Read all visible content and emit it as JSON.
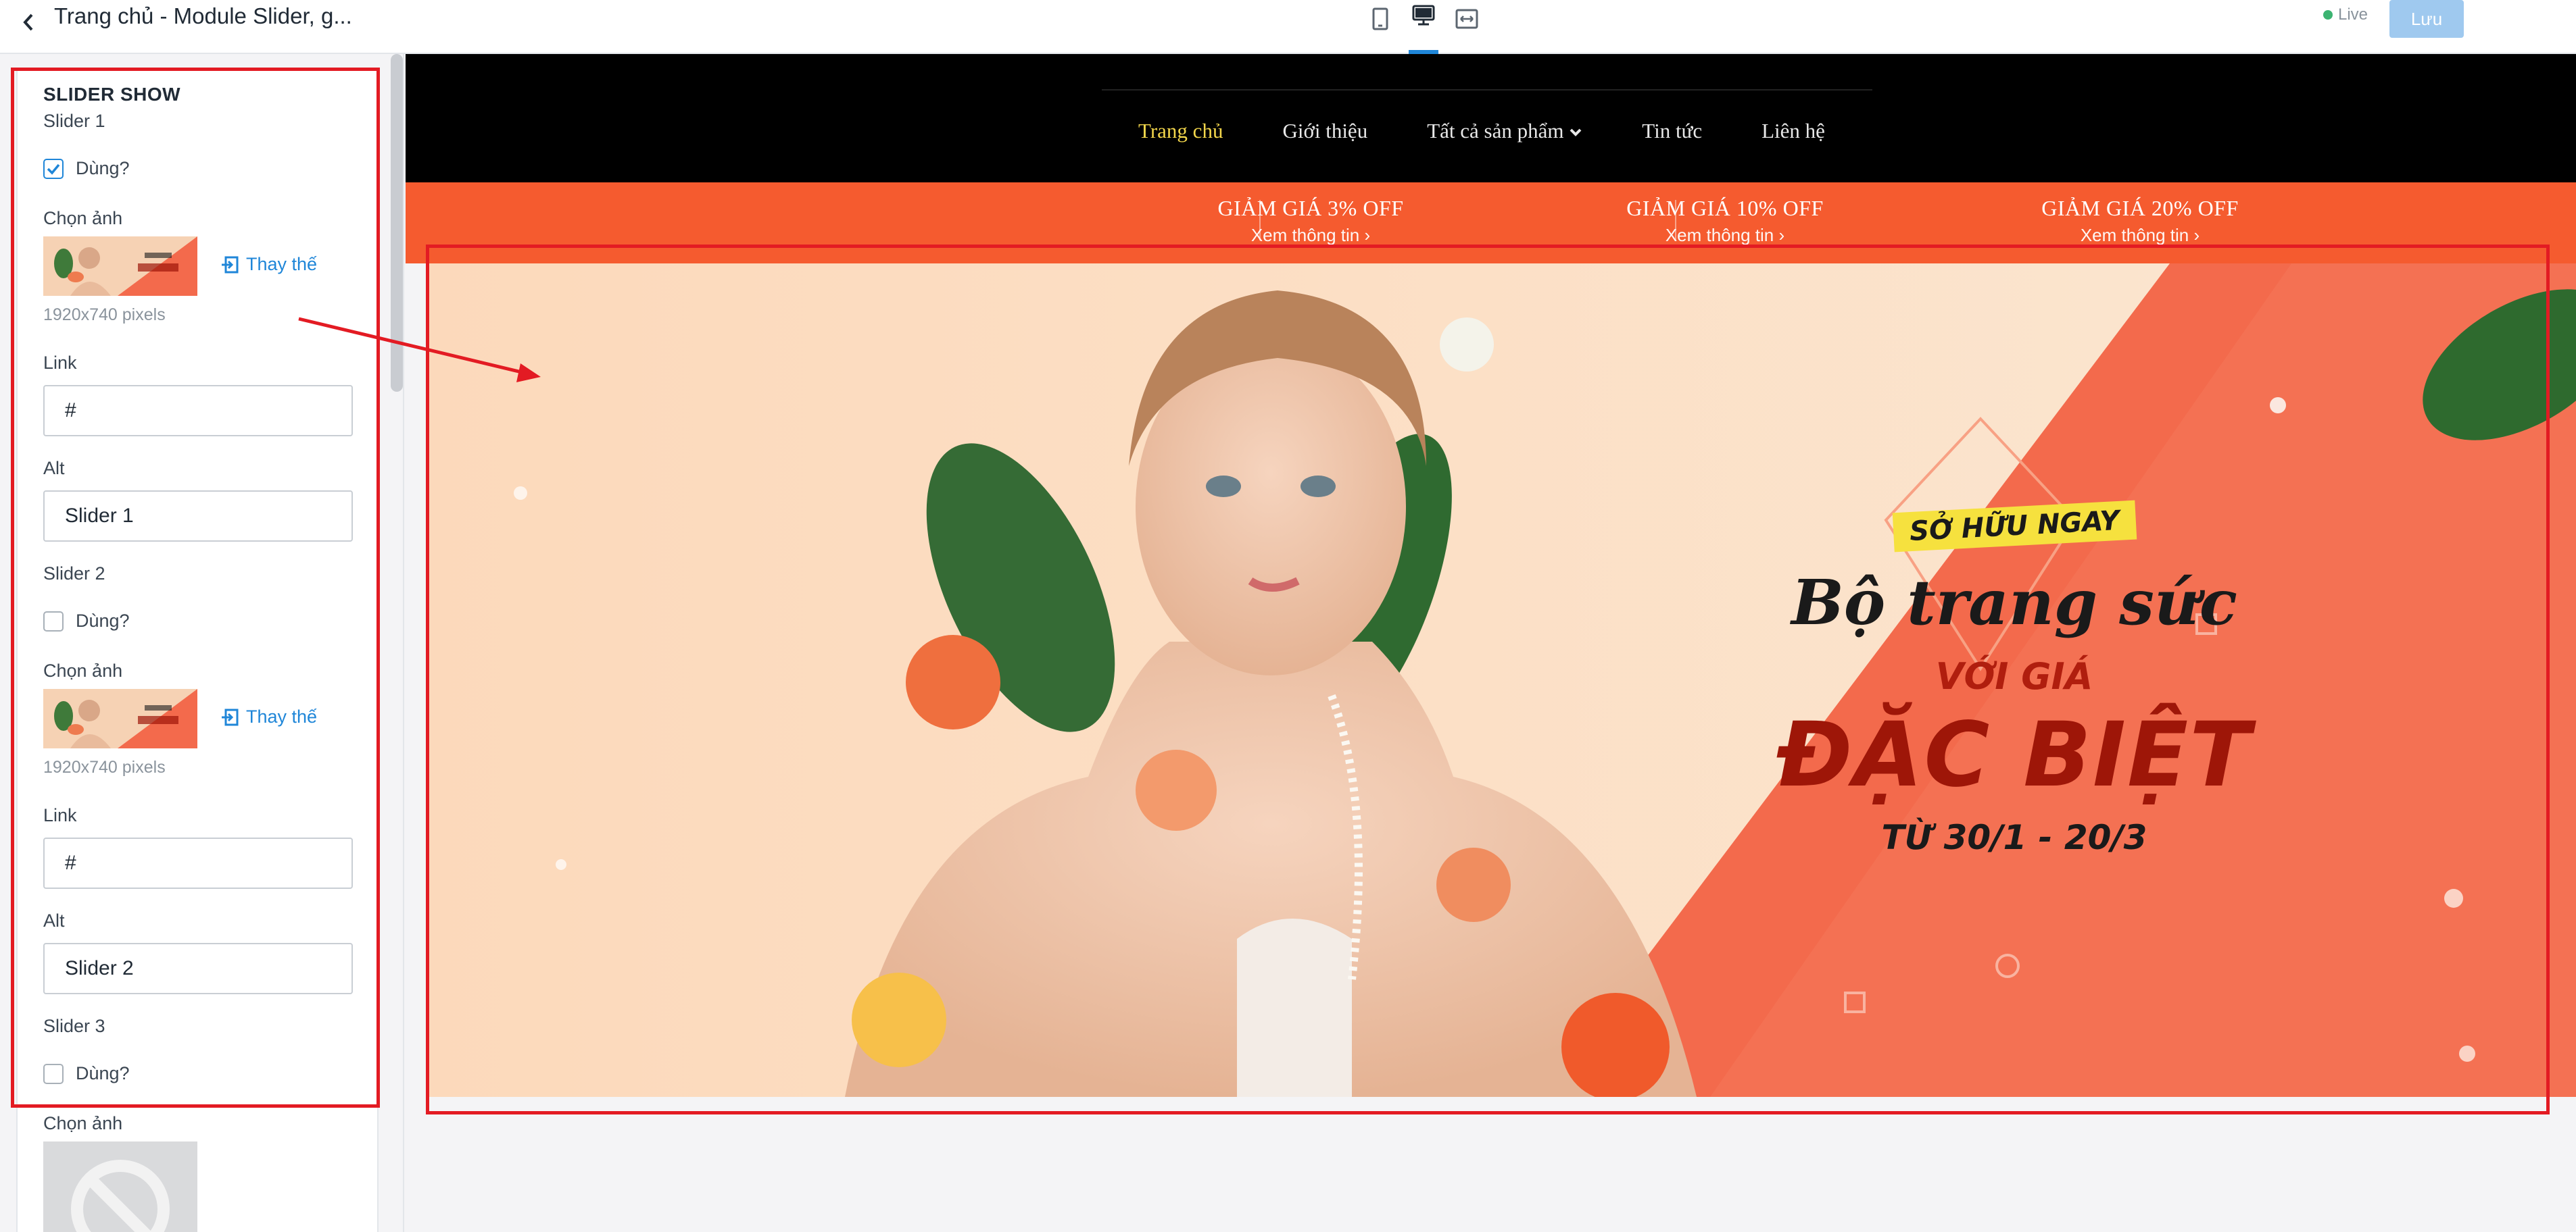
{
  "header": {
    "title": "Trang chủ - Module Slider, g...",
    "live_label": "Live",
    "save_label": "Lưu"
  },
  "sidebar": {
    "section_title": "SLIDER SHOW",
    "sliders": [
      {
        "heading": "Slider 1",
        "use_label": "Dùng?",
        "use_checked": true,
        "image_label": "Chọn ảnh",
        "replace_label": "Thay thế",
        "size_hint": "1920x740 pixels",
        "link_label": "Link",
        "link_value": "#",
        "alt_label": "Alt",
        "alt_value": "Slider 1"
      },
      {
        "heading": "Slider 2",
        "use_label": "Dùng?",
        "use_checked": false,
        "image_label": "Chọn ảnh",
        "replace_label": "Thay thế",
        "size_hint": "1920x740 pixels",
        "link_label": "Link",
        "link_value": "#",
        "alt_label": "Alt",
        "alt_value": "Slider 2"
      },
      {
        "heading": "Slider 3",
        "use_label": "Dùng?",
        "use_checked": false,
        "image_label": "Chọn ảnh"
      }
    ]
  },
  "site": {
    "nav": [
      {
        "label": "Trang chủ",
        "active": true
      },
      {
        "label": "Giới thiệu"
      },
      {
        "label": "Tất cả sản phẩm",
        "dropdown": true
      },
      {
        "label": "Tin tức"
      },
      {
        "label": "Liên hệ"
      }
    ],
    "promos": [
      {
        "title": "GIẢM GIÁ 3% OFF",
        "sub": "Xem thông tin"
      },
      {
        "title": "GIẢM GIÁ 10% OFF",
        "sub": "Xem thông tin"
      },
      {
        "title": "GIẢM GIÁ 20% OFF",
        "sub": "Xem thông tin"
      }
    ],
    "banner": {
      "badge": "SỞ HỮU NGAY",
      "line1": "Bộ trang sức",
      "line2": "VỚI GIÁ",
      "line3": "ĐẶC BIỆT",
      "line4": "TỪ 30/1 - 20/3"
    }
  },
  "colors": {
    "accent": "#1f86d8",
    "highlight": "#e31b23",
    "promo_bar": "#f55b2f",
    "nav_active": "#f3d64b"
  },
  "icons": {
    "back": "chevron-left-icon",
    "devices": [
      "tablet-icon",
      "desktop-icon",
      "fullwidth-icon"
    ],
    "replace": "replace-image-icon"
  }
}
